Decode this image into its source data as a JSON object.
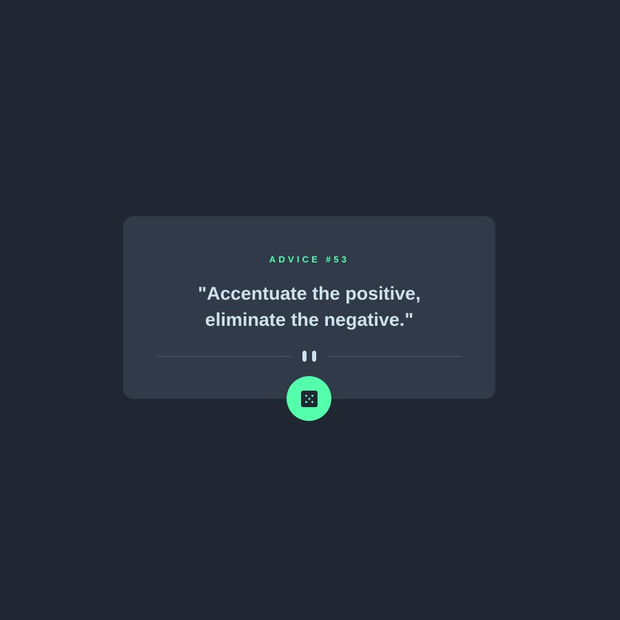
{
  "advice": {
    "id_label": "Advice #53",
    "quote": "\"Accentuate the positive, eliminate the negative.\""
  },
  "icons": {
    "divider_icon": "pause-icon",
    "button_icon": "dice-icon"
  },
  "colors": {
    "background": "#202632",
    "card": "#313a49",
    "accent": "#53ffab",
    "text": "#cee3e9",
    "divider": "#4f5d74"
  }
}
